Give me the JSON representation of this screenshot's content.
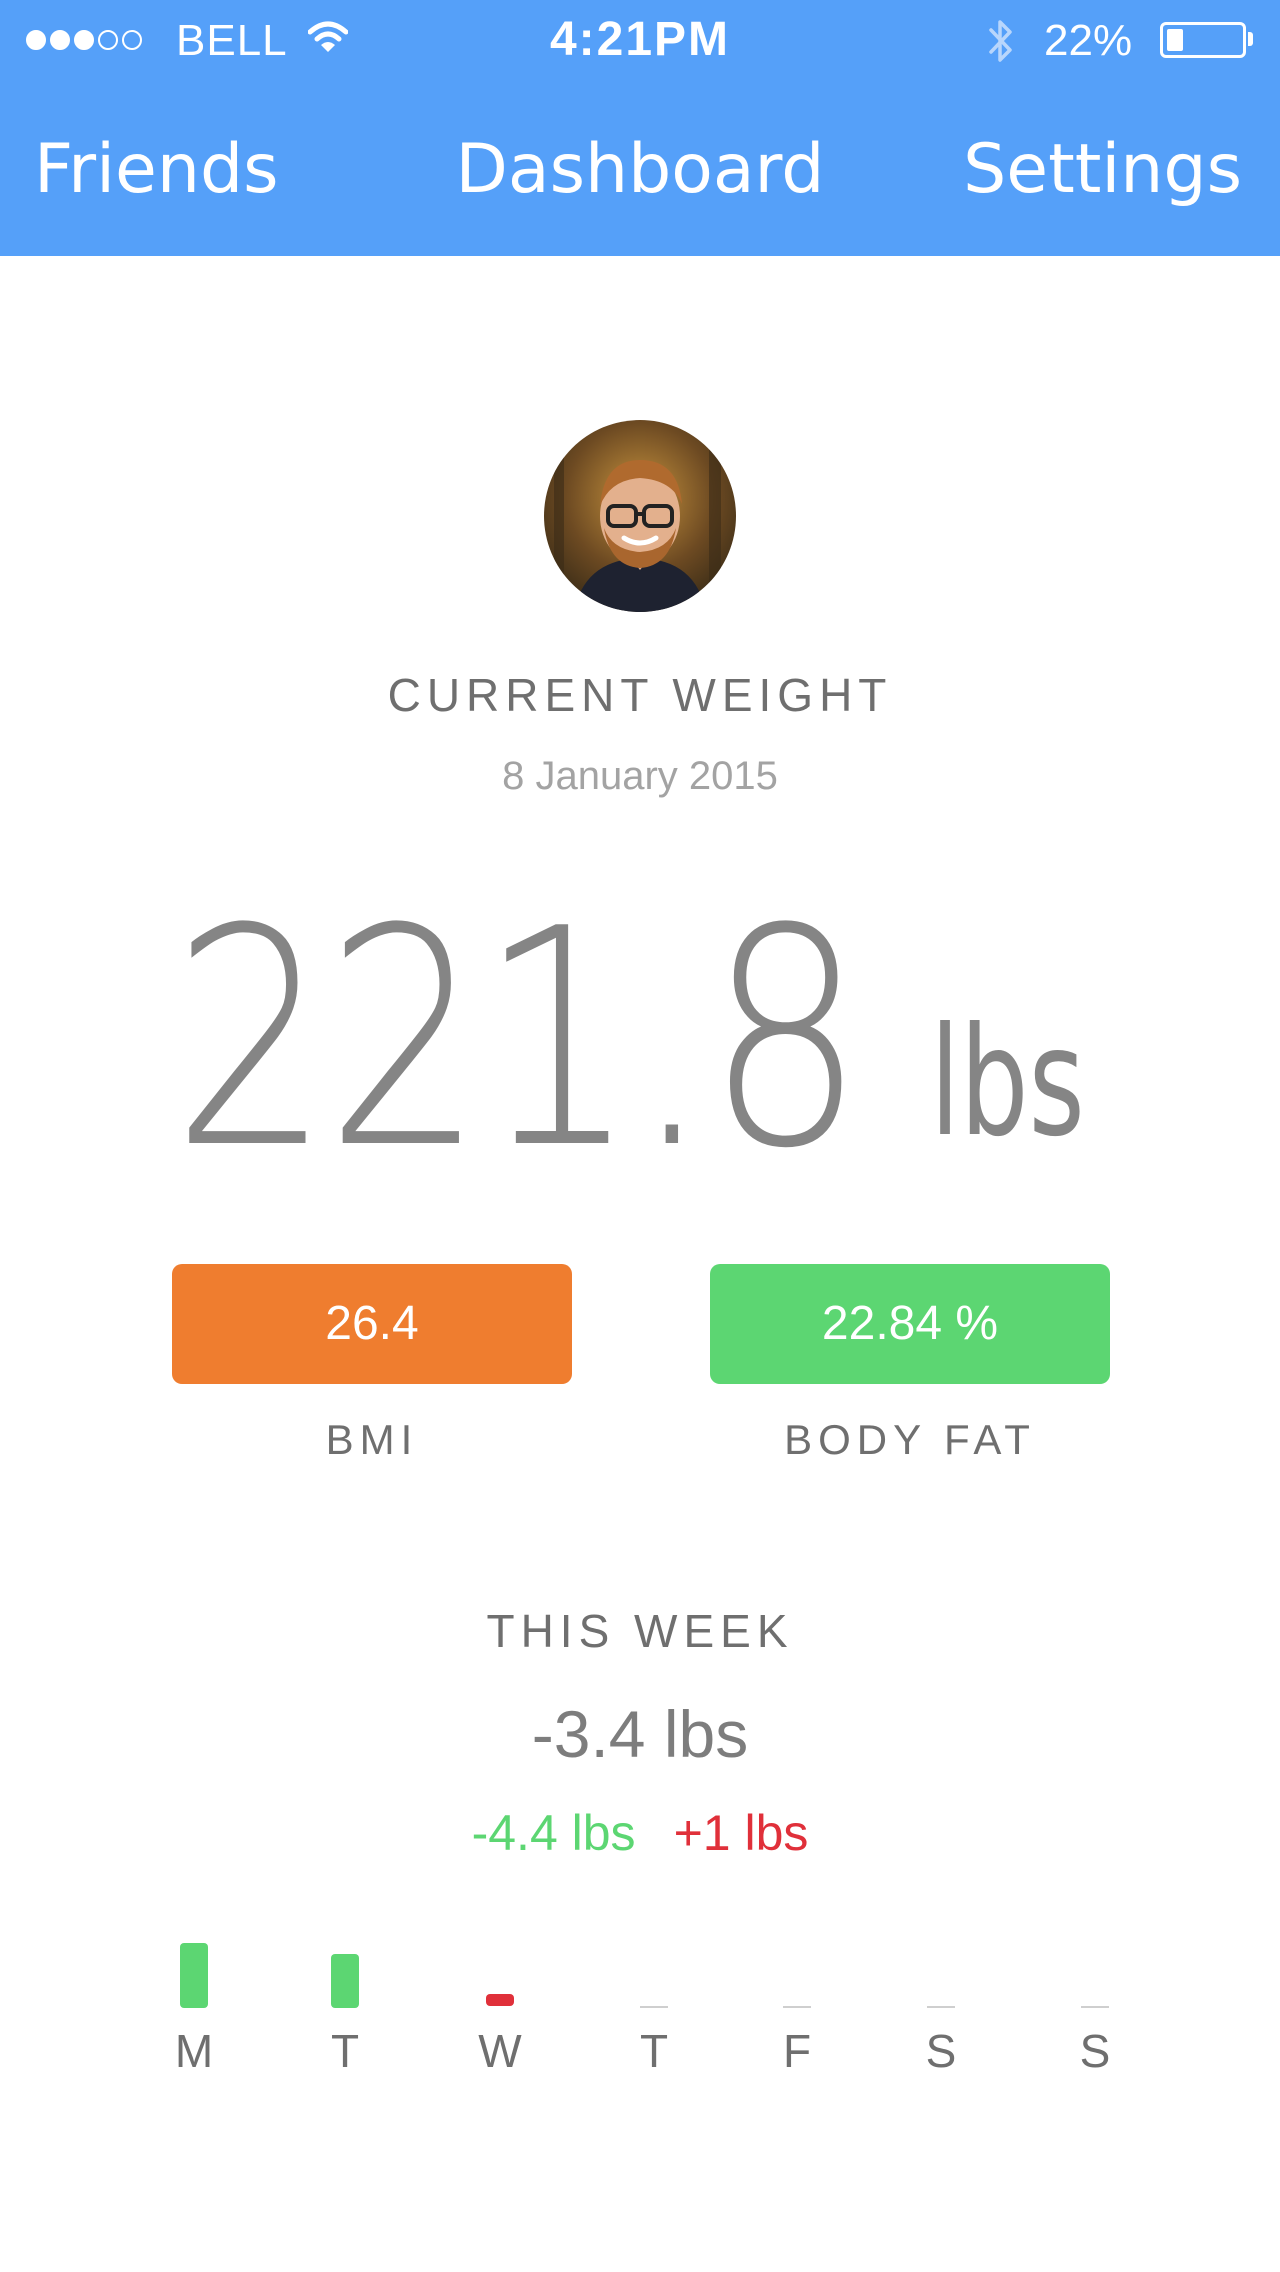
{
  "status_bar": {
    "carrier": "BELL",
    "time": "4:21PM",
    "battery": "22%",
    "battery_level": 0.22,
    "signal_bars": 3,
    "signal_total": 5
  },
  "nav": {
    "left": "Friends",
    "title": "Dashboard",
    "right": "Settings"
  },
  "current_weight": {
    "label": "CURRENT WEIGHT",
    "date": "8 January 2015",
    "value": "221.8",
    "unit": "lbs"
  },
  "stats": {
    "bmi_value": "26.4",
    "bmi_label": "BMI",
    "body_fat_value": "22.84 %",
    "body_fat_label": "BODY FAT"
  },
  "week": {
    "label": "THIS WEEK",
    "change": "-3.4 lbs",
    "loss": "-4.4 lbs",
    "gain": "+1 lbs"
  },
  "days": [
    {
      "letter": "M",
      "change": -2.4
    },
    {
      "letter": "T",
      "change": -2.0
    },
    {
      "letter": "W",
      "change": 1.0
    },
    {
      "letter": "T",
      "change": 0
    },
    {
      "letter": "F",
      "change": 0
    },
    {
      "letter": "S",
      "change": 0
    },
    {
      "letter": "S",
      "change": 0
    }
  ],
  "colors": {
    "header": "#55a0f9",
    "bmi": "#ef7d2f",
    "body_fat": "#5cd672",
    "loss": "#5cd672",
    "gain": "#e0303a"
  }
}
